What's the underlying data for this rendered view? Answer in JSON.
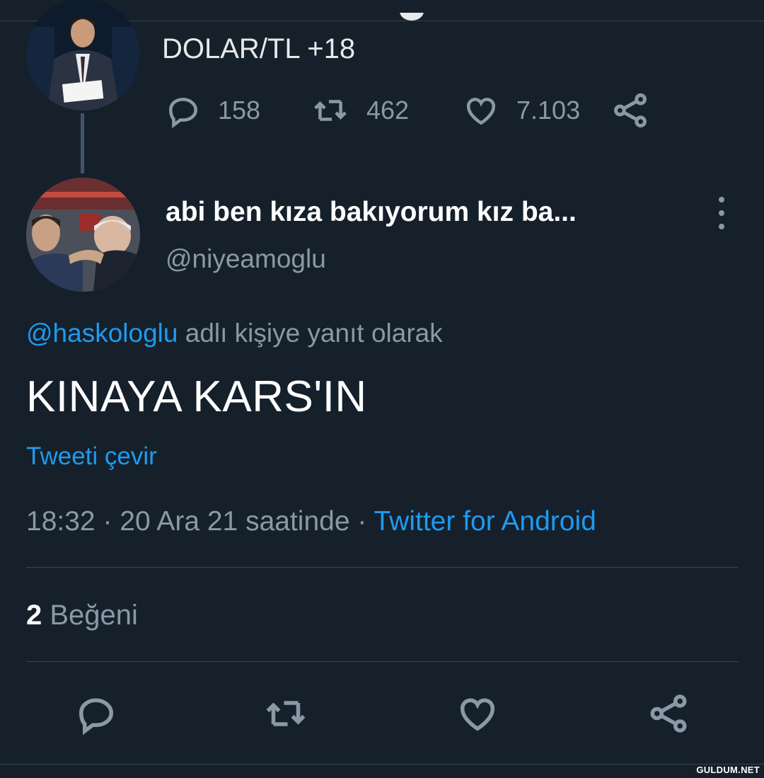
{
  "previous_tweet": {
    "text": "DOLAR/TL +18",
    "replies": "158",
    "retweets": "462",
    "likes": "7.103",
    "icons": [
      "reply-icon",
      "retweet-icon",
      "like-icon",
      "share-icon"
    ]
  },
  "tweet": {
    "display_name": "abi ben kıza bakıyorum kız ba...",
    "handle": "@niyeamoglu",
    "reply_mention": "@haskologlu",
    "reply_suffix": " adlı kişiye yanıt olarak",
    "text": "KINAYA KARS'IN",
    "translate_label": "Tweeti çevir",
    "time": "18:32",
    "separator": " · ",
    "date": "20 Ara 21 saatinde",
    "source": "Twitter for Android",
    "likes_count": "2",
    "likes_label": "Beğeni"
  },
  "bottom_actions": [
    "reply-icon",
    "retweet-icon",
    "like-icon",
    "share-icon"
  ],
  "watermark": "GULDUM.NET",
  "colors": {
    "background": "#15202b",
    "accent": "#1d9bf0",
    "secondary_text": "#8b98a5",
    "divider": "#38444d"
  }
}
